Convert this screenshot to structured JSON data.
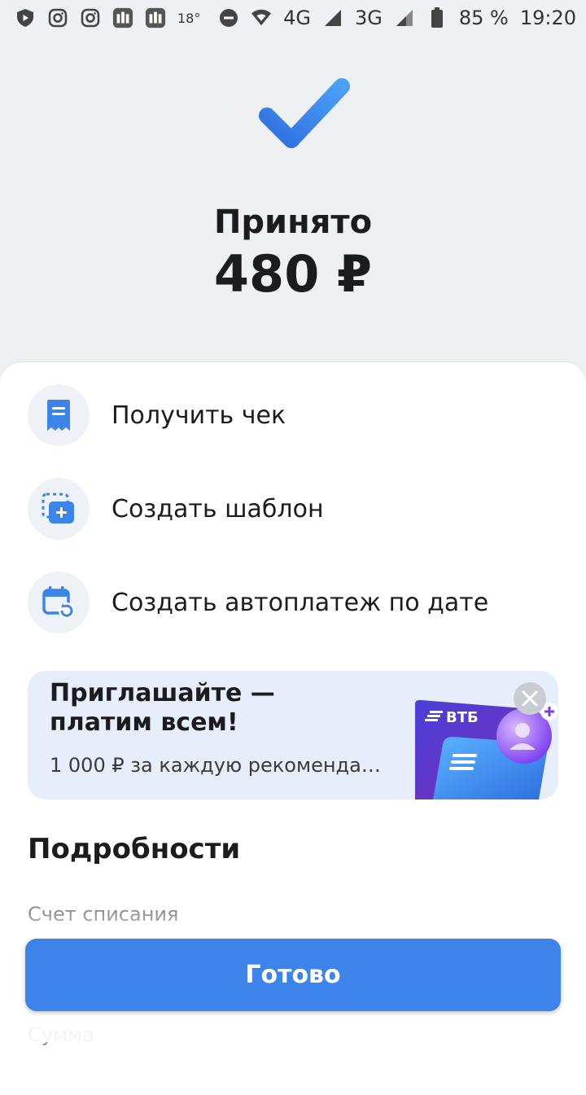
{
  "status_bar": {
    "temperature": "18°",
    "network_4g": "4G",
    "network_3g": "3G",
    "battery": "85 %",
    "time": "19:20"
  },
  "header": {
    "title": "Принято",
    "amount": "480 ₽"
  },
  "actions": [
    {
      "label": "Получить чек",
      "icon": "receipt-icon"
    },
    {
      "label": "Создать шаблон",
      "icon": "template-add-icon"
    },
    {
      "label": "Создать автоплатеж по дате",
      "icon": "calendar-repeat-icon"
    }
  ],
  "promo": {
    "title": "Приглашайте — платим всем!",
    "subtitle": "1 000 ₽ за каждую рекоменда…",
    "brand": "ВТБ"
  },
  "details": {
    "title": "Подробности",
    "debit_account_label": "Счет списания",
    "amount_label": "Сумма"
  },
  "footer": {
    "done_label": "Готово"
  },
  "colors": {
    "accent": "#3d84ea",
    "background": "#eef0f3",
    "promo_bg": "#e6eefc"
  }
}
